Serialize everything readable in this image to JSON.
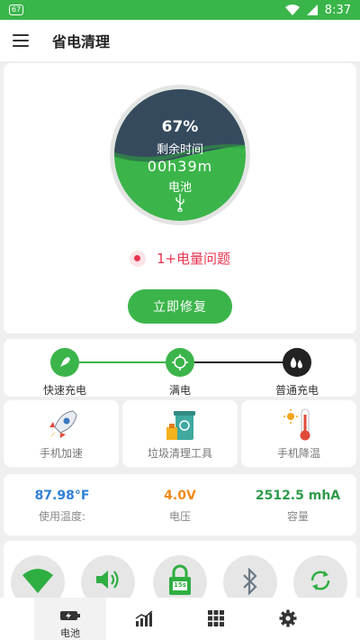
{
  "status_bar": {
    "battery_level": "67",
    "time": "8:37"
  },
  "header": {
    "title": "省电清理"
  },
  "battery": {
    "percent_text": "67%",
    "percent": 67,
    "remaining_label": "剩余时间",
    "remaining_time": "00h39m",
    "source_label": "电池",
    "icon": "usb-icon"
  },
  "issues": {
    "label": "1+电量问题"
  },
  "fix_button": {
    "label": "立即修复"
  },
  "charge_stages": [
    {
      "label": "快速充电",
      "icon": "rocket-icon",
      "color": "#3bb54a"
    },
    {
      "label": "满电",
      "icon": "refresh-target-icon",
      "color": "#3bb54a"
    },
    {
      "label": "普通充电",
      "icon": "drops-icon",
      "color": "#222222"
    }
  ],
  "tools": [
    {
      "label": "手机加速",
      "icon": "rocket-icon"
    },
    {
      "label": "垃圾清理工具",
      "icon": "trash-bin-icon"
    },
    {
      "label": "手机降温",
      "icon": "thermometer-icon"
    }
  ],
  "stats": [
    {
      "value": "87.98°F",
      "label": "使用温度:",
      "color": "#2f7fd6"
    },
    {
      "value": "4.0V",
      "label": "电压",
      "color": "#ef8a1c"
    },
    {
      "value": "2512.5 mhA",
      "label": "容量",
      "color": "#2e9a4a"
    }
  ],
  "toggles": [
    {
      "icon": "wifi-icon"
    },
    {
      "icon": "volume-icon"
    },
    {
      "icon": "screen-timeout-icon",
      "text": "15s"
    },
    {
      "icon": "bluetooth-icon"
    },
    {
      "icon": "auto-rotate-icon"
    }
  ],
  "tab_bar": [
    {
      "label": "电池",
      "icon": "battery-icon",
      "active": true
    },
    {
      "label": "",
      "icon": "chart-icon"
    },
    {
      "label": "",
      "icon": "apps-grid-icon"
    },
    {
      "label": "",
      "icon": "settings-gear-icon"
    }
  ],
  "colors": {
    "accent": "#3bb54a",
    "warning": "#e8334f",
    "dark_wave": "#364a5e"
  }
}
